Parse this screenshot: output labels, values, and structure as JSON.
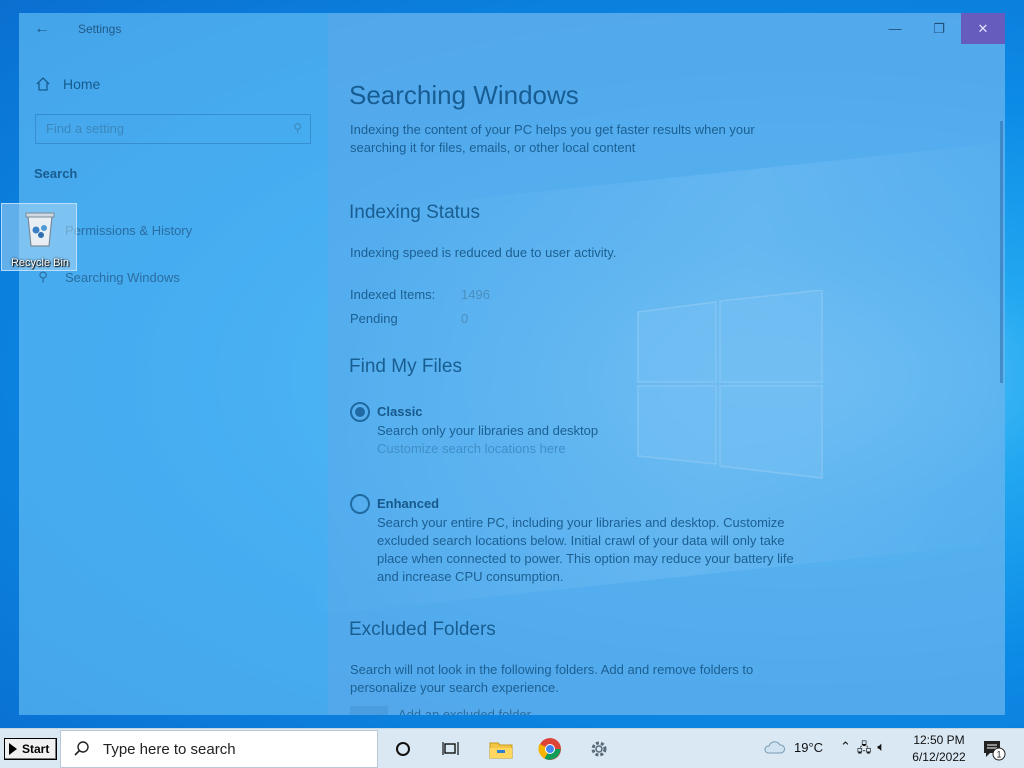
{
  "desktop": {
    "recycle_bin_label": "Recycle Bin"
  },
  "window": {
    "title": "Settings",
    "controls": {
      "minimize": "—",
      "restore": "❐",
      "close": "✕"
    }
  },
  "sidebar": {
    "home_label": "Home",
    "search_placeholder": "Find a setting",
    "section_heading": "Search",
    "items": [
      {
        "label": "Permissions & History",
        "icon": "lock-icon"
      },
      {
        "label": "Searching Windows",
        "icon": "search-icon"
      }
    ]
  },
  "main": {
    "title": "Searching Windows",
    "intro": "Indexing the content of your PC helps you get faster results when your searching it for files, emails, or other local content",
    "indexing": {
      "heading": "Indexing Status",
      "status_text": "Indexing speed is reduced due to user activity.",
      "indexed_label": "Indexed Items:",
      "indexed_value": "1496",
      "pending_label": "Pending",
      "pending_value": "0"
    },
    "find_files": {
      "heading": "Find My Files",
      "classic": {
        "label": "Classic",
        "description": "Search only your libraries and desktop",
        "link": "Customize search locations here",
        "selected": true
      },
      "enhanced": {
        "label": "Enhanced",
        "description": "Search your entire PC, including your libraries and desktop. Customize excluded search locations below. Initial crawl of your data will only take place when connected to power. This option may reduce your battery life and increase CPU consumption.",
        "selected": false
      }
    },
    "excluded": {
      "heading": "Excluded Folders",
      "description": "Search will not look in the following folders. Add and remove folders to personalize your search experience.",
      "add_label": "Add an excluded folder"
    }
  },
  "taskbar": {
    "start_label": "Start",
    "search_placeholder": "Type here to search",
    "temperature": "19°C",
    "time": "12:50 PM",
    "date": "6/12/2022",
    "notification_count": "1"
  }
}
